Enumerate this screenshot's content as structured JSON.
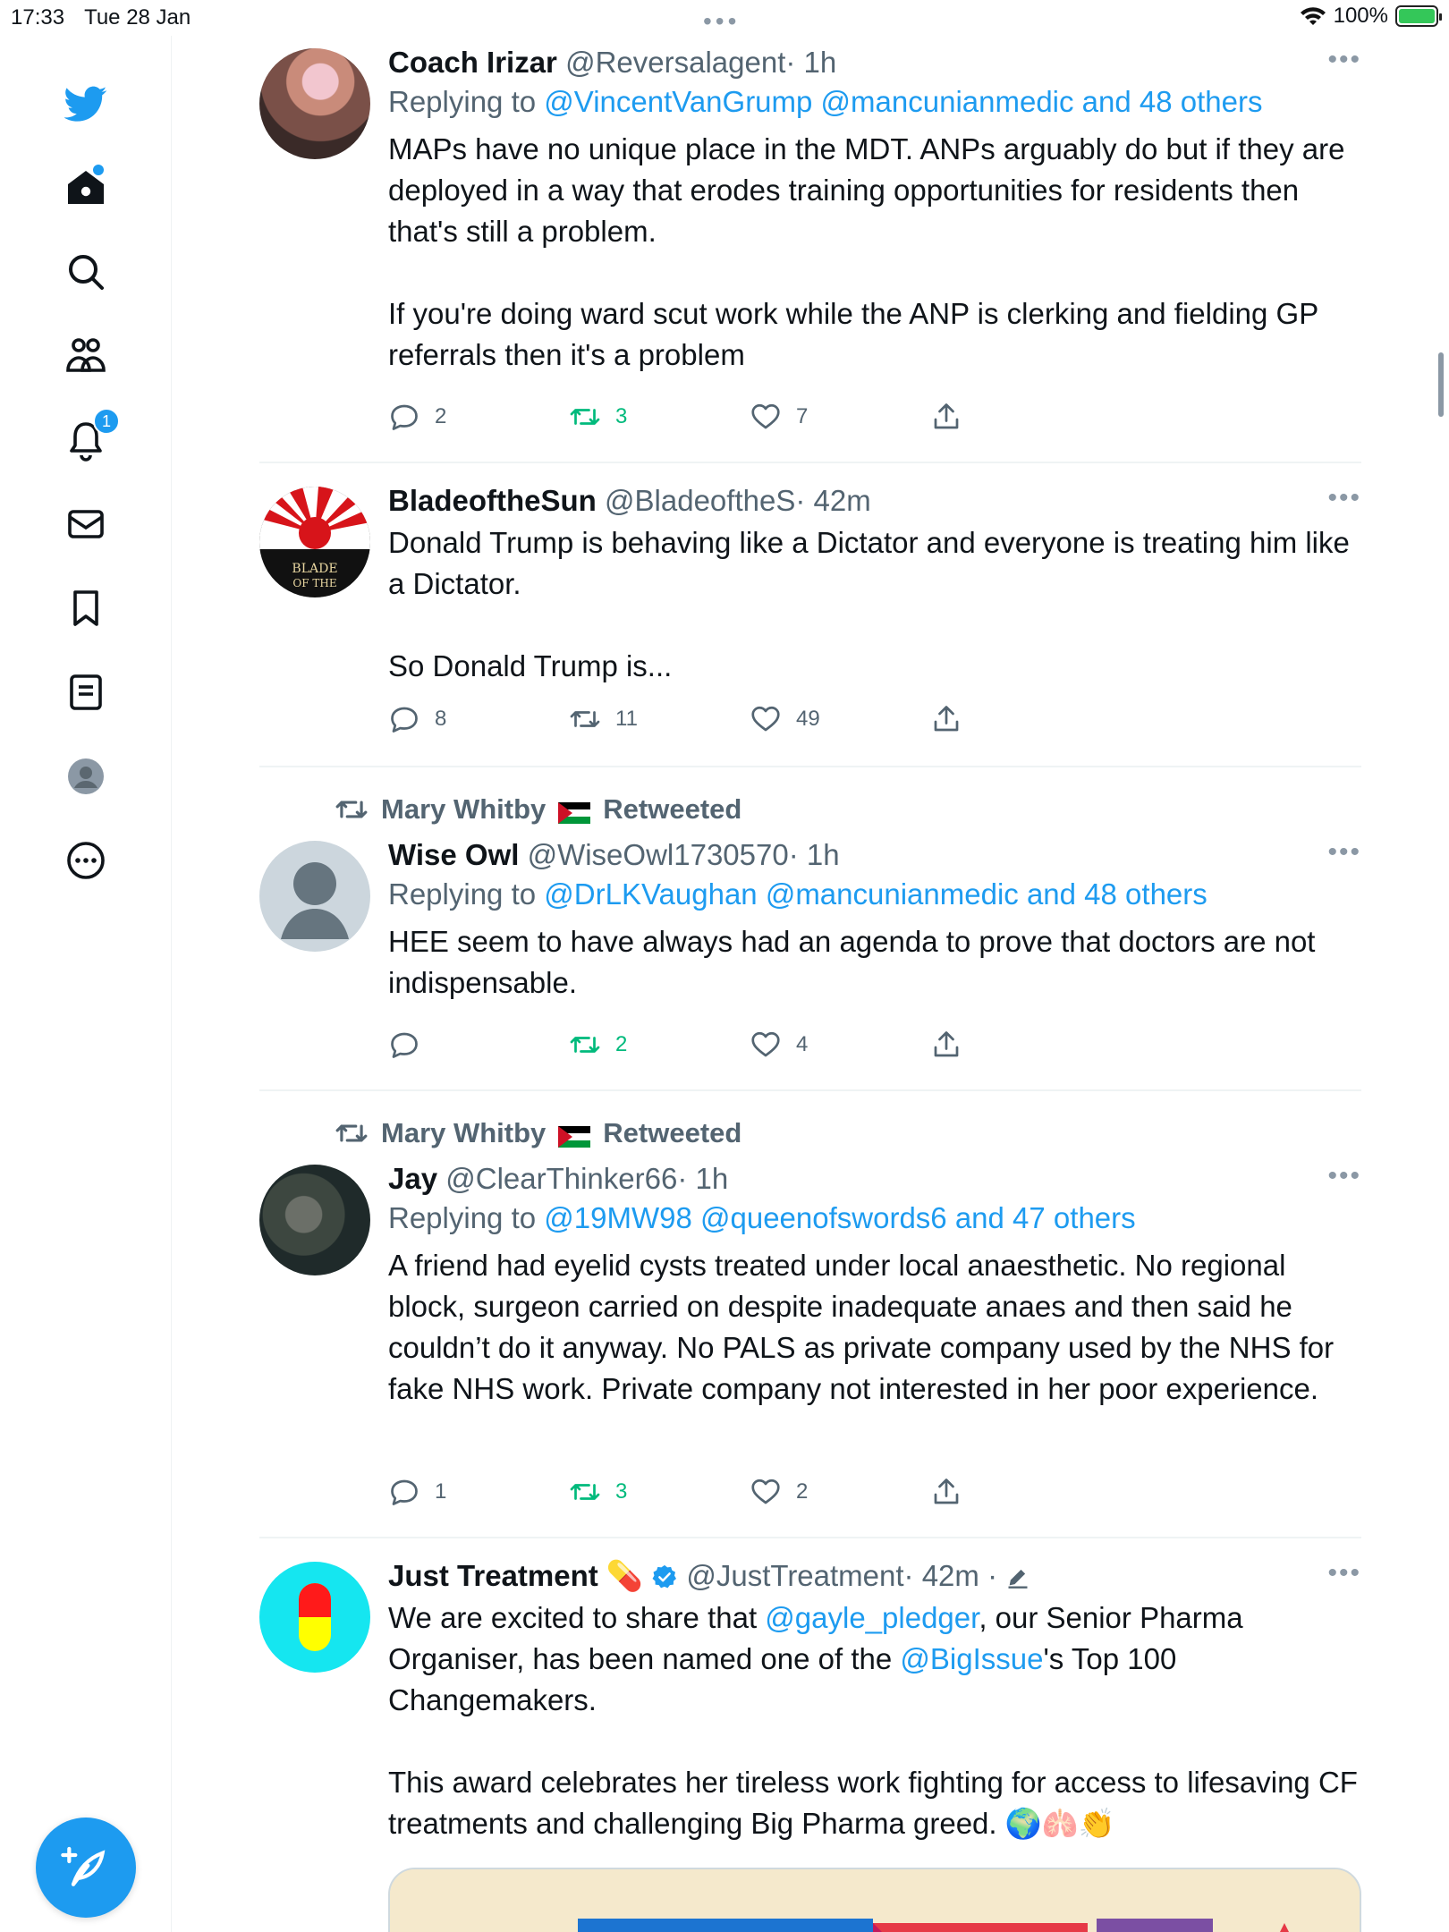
{
  "status_bar": {
    "time": "17:33",
    "date": "Tue 28 Jan",
    "battery": "100%"
  },
  "colors": {
    "accent": "#1d9bf0",
    "retweet_active": "#00ba7c",
    "secondary_text": "#536471"
  },
  "sidebar": {
    "items": [
      {
        "name": "twitter-logo",
        "icon": "bird-icon"
      },
      {
        "name": "home",
        "icon": "home-icon"
      },
      {
        "name": "explore",
        "icon": "search-icon"
      },
      {
        "name": "communities",
        "icon": "people-icon"
      },
      {
        "name": "notifications",
        "icon": "bell-icon",
        "badge": "1"
      },
      {
        "name": "messages",
        "icon": "envelope-icon"
      },
      {
        "name": "bookmarks",
        "icon": "bookmark-icon"
      },
      {
        "name": "lists",
        "icon": "list-icon"
      },
      {
        "name": "profile",
        "icon": "avatar-icon"
      },
      {
        "name": "more",
        "icon": "more-circle-icon"
      }
    ],
    "compose_icon": "compose-icon"
  },
  "tweets": [
    {
      "name": "Coach Irizar",
      "handle": "@Reversalagent",
      "time": "· 1h",
      "replying_prefix": "Replying to",
      "replying_to": "@VincentVanGrump @mancunianmedic and 48 others",
      "text": "MAPs have no unique place in the MDT. ANPs arguably do but if they are deployed in a way that erodes training opportunities for residents then that's still a problem.\n\nIf you're doing ward scut work while the ANP is clerking and fielding GP referrals then it's a problem",
      "replies": "2",
      "retweets": "3",
      "likes": "7"
    },
    {
      "name": "BladeoftheSun",
      "handle": "@BladeoftheS",
      "time": "· 42m",
      "text": "Donald Trump is behaving like a Dictator and everyone is treating him like a Dictator.\n\nSo Donald Trump is...",
      "replies": "8",
      "retweets": "11",
      "likes": "49"
    },
    {
      "retweeted_by": "Mary Whitby",
      "retweeted_label": "Retweeted",
      "name": "Wise Owl",
      "handle": "@WiseOwl1730570",
      "time": "· 1h",
      "replying_prefix": "Replying to",
      "replying_to": "@DrLKVaughan @mancunianmedic and 48 others",
      "text": "HEE seem to have  always had an agenda to prove that doctors are not indispensable.",
      "replies": "",
      "retweets": "2",
      "likes": "4"
    },
    {
      "retweeted_by": "Mary Whitby",
      "retweeted_label": "Retweeted",
      "name": "Jay",
      "handle": "@ClearThinker66",
      "time": "· 1h",
      "replying_prefix": "Replying to",
      "replying_to": "@19MW98 @queenofswords6 and 47 others",
      "text": "A friend had eyelid cysts treated under local anaesthetic. No regional block, surgeon carried on despite inadequate anaes and then said he couldn’t do it anyway. No PALS as private company used by the NHS for fake NHS work. Private company not interested in her poor experience.",
      "replies": "1",
      "retweets": "3",
      "likes": "2"
    },
    {
      "name": "Just Treatment",
      "name_emoji": "💊",
      "handle": "@JustTreatment",
      "time": "· 42m ·",
      "text_part1": "We are excited to share that ",
      "mention1": "@gayle_pledger",
      "text_part2": ", our Senior Pharma Organiser, has been named one of the ",
      "mention2": "@BigIssue",
      "text_part3": "'s Top 100 Changemakers.",
      "text_part4": "This award celebrates her tireless work fighting for  access to lifesaving CF treatments and challenging Big Pharma greed. 🌍🫁👏"
    }
  ],
  "more_label": "•••"
}
